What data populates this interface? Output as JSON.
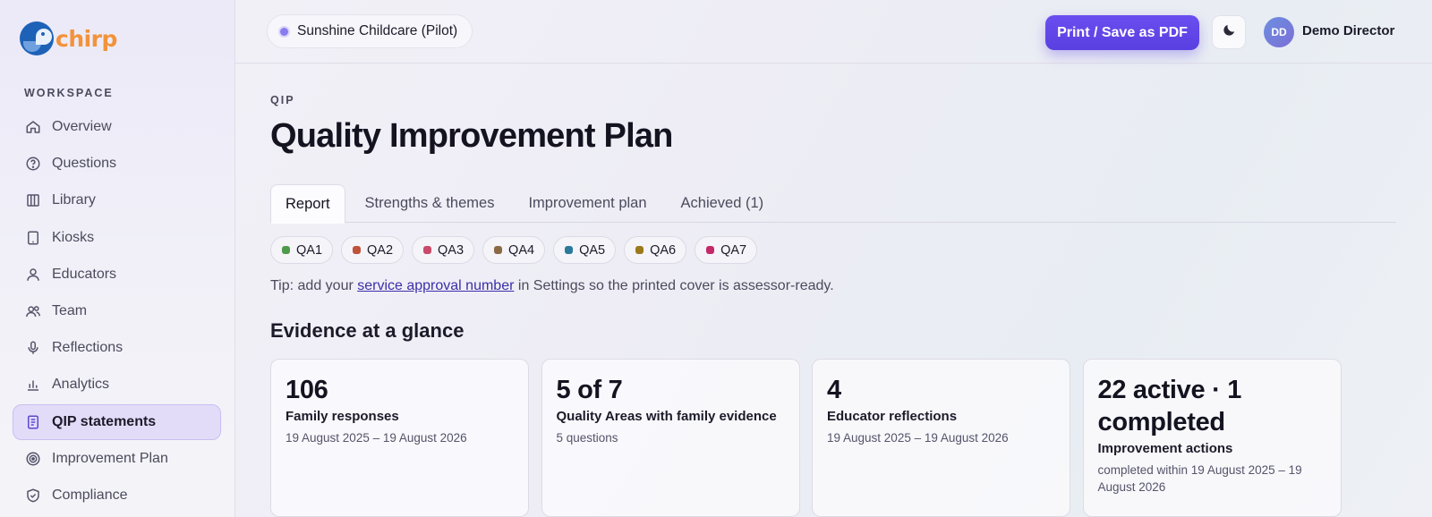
{
  "app": {
    "name": "chirp"
  },
  "sidebar": {
    "section_label": "WORKSPACE",
    "items": [
      {
        "label": "Overview",
        "icon": "home-icon"
      },
      {
        "label": "Questions",
        "icon": "help-circle-icon"
      },
      {
        "label": "Library",
        "icon": "library-icon"
      },
      {
        "label": "Kiosks",
        "icon": "tablet-icon"
      },
      {
        "label": "Educators",
        "icon": "user-icon"
      },
      {
        "label": "Team",
        "icon": "users-icon"
      },
      {
        "label": "Reflections",
        "icon": "microphone-icon"
      },
      {
        "label": "Analytics",
        "icon": "bar-chart-icon"
      },
      {
        "label": "QIP statements",
        "icon": "document-icon",
        "active": true
      },
      {
        "label": "Improvement Plan",
        "icon": "target-icon"
      },
      {
        "label": "Compliance",
        "icon": "shield-check-icon"
      }
    ]
  },
  "topbar": {
    "org_name": "Sunshine Childcare (Pilot)",
    "print_label": "Print / Save as PDF",
    "theme_icon": "moon-icon",
    "avatar_initials": "DD",
    "user_name": "Demo Director"
  },
  "page": {
    "eyebrow": "QIP",
    "title": "Quality Improvement Plan",
    "tabs": [
      {
        "label": "Report",
        "active": true
      },
      {
        "label": "Strengths & themes"
      },
      {
        "label": "Improvement plan"
      },
      {
        "label": "Achieved (1)"
      }
    ],
    "quality_areas": [
      {
        "label": "QA1",
        "color": "#4f9a4a"
      },
      {
        "label": "QA2",
        "color": "#c0513a"
      },
      {
        "label": "QA3",
        "color": "#c94a6a"
      },
      {
        "label": "QA4",
        "color": "#8a6a45"
      },
      {
        "label": "QA5",
        "color": "#2a7a9a"
      },
      {
        "label": "QA6",
        "color": "#9a7a1a"
      },
      {
        "label": "QA7",
        "color": "#c42a6a"
      }
    ],
    "tip": {
      "prefix": "Tip: add your ",
      "link": "service approval number",
      "suffix": " in Settings so the printed cover is assessor-ready."
    },
    "section_title": "Evidence at a glance",
    "cards": [
      {
        "value": "106",
        "label": "Family responses",
        "sub": "19 August 2025 – 19 August 2026"
      },
      {
        "value": "5 of 7",
        "label": "Quality Areas with family evidence",
        "sub": "5 questions"
      },
      {
        "value": "4",
        "label": "Educator reflections",
        "sub": "19 August 2025 – 19 August 2026"
      },
      {
        "value": "22 active · 1 completed",
        "label": "Improvement actions",
        "sub": "completed within 19 August 2025 – 19 August 2026"
      }
    ]
  },
  "colors": {
    "accent": "#5a3fe0",
    "logo": "#f2933a",
    "logo_mark": "#1e62b8"
  }
}
